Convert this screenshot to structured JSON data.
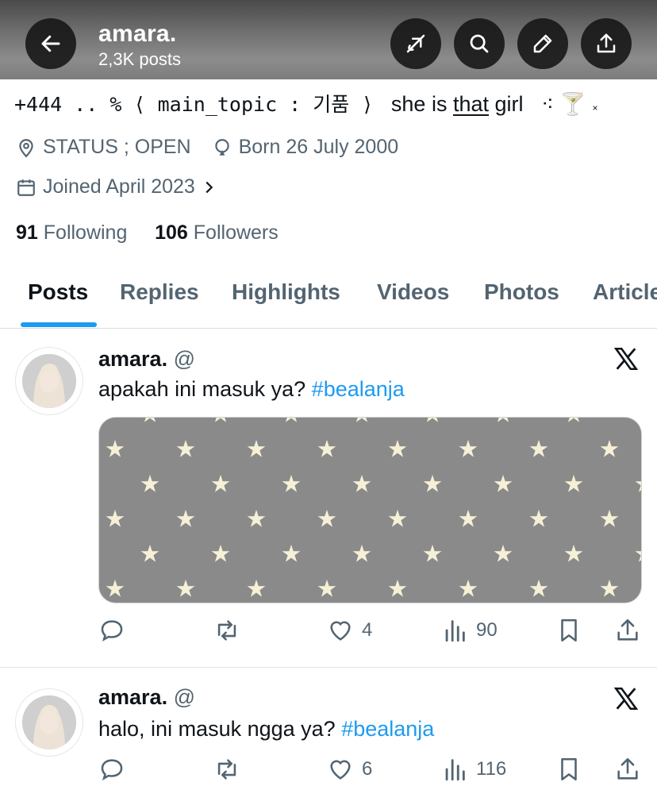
{
  "header": {
    "title": "amara.",
    "subtitle": "2,3K posts",
    "buttons": [
      "back-arrow-icon",
      "no-grok-icon",
      "search-icon",
      "edit-icon",
      "share-icon"
    ]
  },
  "bio": {
    "part1": "+444 .. % ⟨ main_topic :  기품 ⟩",
    "part2": "she is",
    "part3": "that",
    "part4": "girl",
    "part5": "⁖ 🍸",
    "part6": "×"
  },
  "meta": {
    "location": "STATUS ; OPEN",
    "birth": "Born 26 July 2000",
    "joined": "Joined April 2023"
  },
  "stats": {
    "following_count": "91",
    "following_label": "Following",
    "followers_count": "106",
    "followers_label": "Followers"
  },
  "tabs": [
    {
      "label": "Posts",
      "active": true
    },
    {
      "label": "Replies"
    },
    {
      "label": "Highlights"
    },
    {
      "label": "Videos"
    },
    {
      "label": "Photos"
    },
    {
      "label": "Articles"
    }
  ],
  "posts": [
    {
      "name": "amara.",
      "handle": "@",
      "text": "apakah ini masuk ya?",
      "hashtag": "#bealanja",
      "likes": "4",
      "views": "90",
      "has_media": true
    },
    {
      "name": "amara.",
      "handle": "@",
      "text": "halo, ini masuk ngga ya?",
      "hashtag": "#bealanja",
      "likes": "6",
      "views": "116",
      "has_media": false
    }
  ],
  "colors": {
    "accent": "#1d9bf0",
    "secondary_text": "#536471",
    "media_bg": "#8a8a8a",
    "star": "#f5f0d6"
  }
}
